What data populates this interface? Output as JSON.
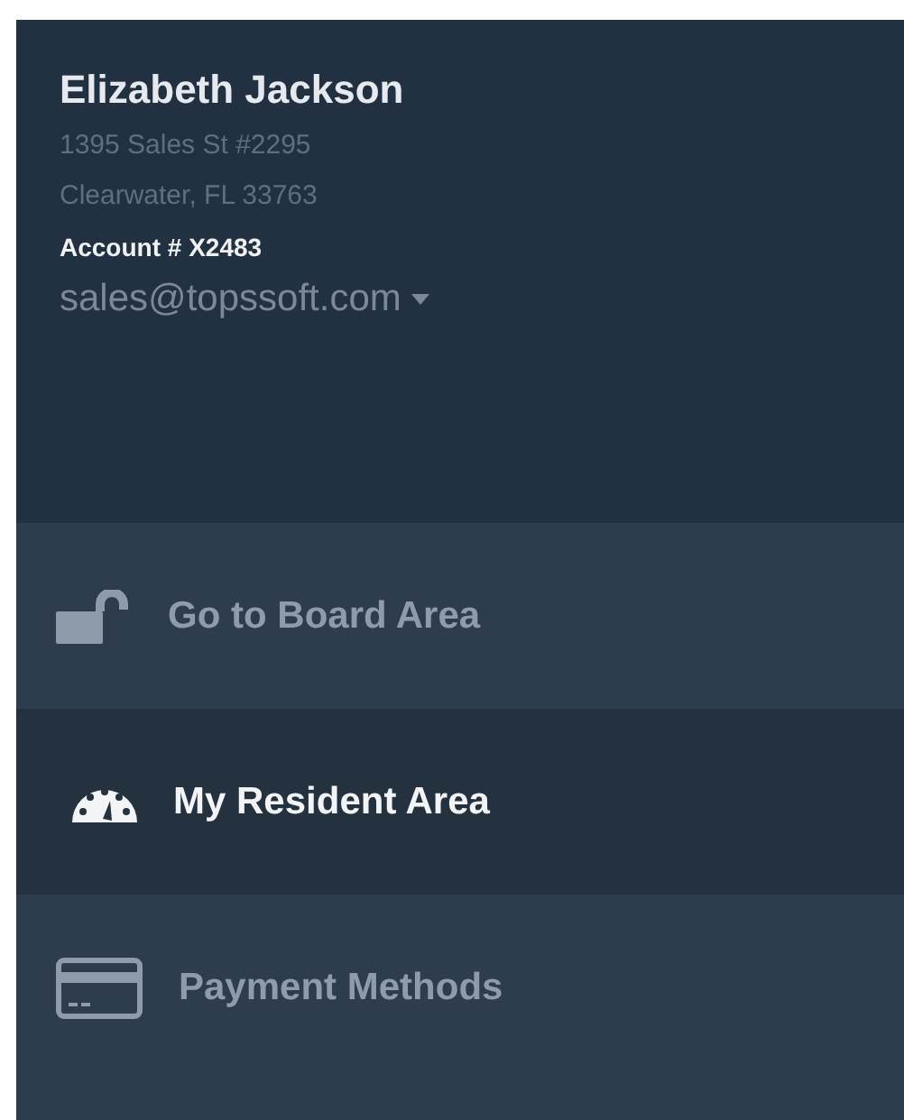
{
  "profile": {
    "name": "Elizabeth Jackson",
    "address_line_1": "1395 Sales St #2295",
    "address_line_2": "Clearwater, FL 33763",
    "account": "Account # X2483",
    "email": "sales@topssoft.com"
  },
  "menu": [
    {
      "label": "Go to Board Area",
      "selected": false
    },
    {
      "label": "My Resident Area",
      "selected": true
    },
    {
      "label": "Payment Methods",
      "selected": false
    }
  ]
}
